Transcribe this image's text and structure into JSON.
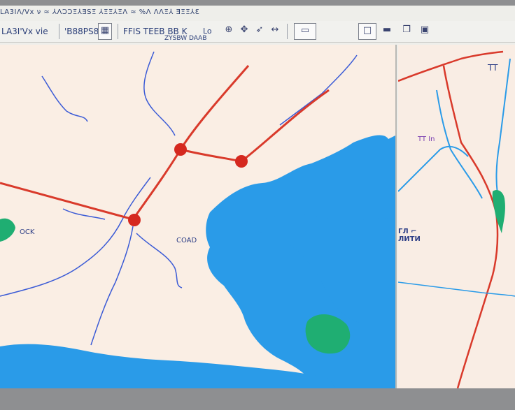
{
  "menubar": {
    "text": "LA3IΛ/Vx ν ≈ ⅄ΛϽϽΞ⅄ƎSΞ ⅄ΞΞ⅄ΞΛ ≈ %Λ ΛΛΞ⅄ ƎΞΞ⅄Ɛ"
  },
  "toolbar": {
    "text_group_1": "LA3I'Vx vie",
    "text_group_2": "'B88PS8S",
    "text_group_3": "FFIS TEEB BB K",
    "text_group_4": "Lo",
    "text_group_5": "ZYSBW DAAB",
    "icons": [
      "layers-icon",
      "zoom-in-icon",
      "pan-icon",
      "select-icon",
      "measure-icon",
      "print-icon"
    ],
    "window_controls": [
      "minimize-icon",
      "maximize-icon",
      "restore-icon",
      "close-icon"
    ]
  },
  "map_main": {
    "labels": {
      "place_left": "OCK",
      "place_center": "COAD"
    },
    "route_color": "#d93a2b",
    "water_color": "#2a9be8",
    "river_color": "#3b5bd6",
    "park_color": "#1fae72"
  },
  "map_side": {
    "labels": {
      "top_label": "TT",
      "mid_label": "TT In",
      "lower_label": "ГЛ ⌐\nЛИТИ"
    }
  }
}
